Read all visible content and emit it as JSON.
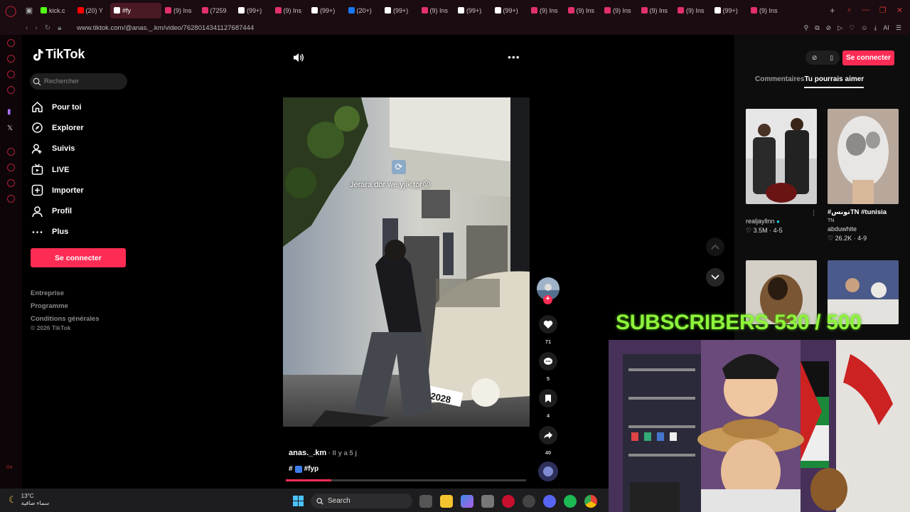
{
  "browser": {
    "tabs": [
      {
        "label": "",
        "color": "#ffffff",
        "icon": "grid-icon"
      },
      {
        "label": "kick.c",
        "color": "#53fc18",
        "icon": "kick-icon"
      },
      {
        "label": "(20) Y",
        "color": "#ff0000",
        "icon": "youtube-icon"
      },
      {
        "label": "#fy",
        "color": "#ffffff",
        "icon": "tiktok-icon",
        "active": true
      },
      {
        "label": "(9) Ins",
        "color": "#e1306c",
        "icon": "instagram-icon"
      },
      {
        "label": "(7259",
        "color": "#e1306c",
        "icon": "instagram-icon"
      },
      {
        "label": "(99+)",
        "color": "#ffffff",
        "icon": "tiktok-icon"
      },
      {
        "label": "(9) Ins",
        "color": "#e1306c",
        "icon": "instagram-icon"
      },
      {
        "label": "(99+)",
        "color": "#ffffff",
        "icon": "tiktok-icon"
      },
      {
        "label": "(20+)",
        "color": "#1877f2",
        "icon": "facebook-icon"
      },
      {
        "label": "(99+)",
        "color": "#ffffff",
        "icon": "tiktok-icon"
      },
      {
        "label": "(9) Ins",
        "color": "#e1306c",
        "icon": "instagram-icon"
      },
      {
        "label": "(99+)",
        "color": "#ffffff",
        "icon": "tiktok-icon"
      },
      {
        "label": "(99+)",
        "color": "#ffffff",
        "icon": "tiktok-icon"
      },
      {
        "label": "(9) Ins",
        "color": "#e1306c",
        "icon": "instagram-icon"
      },
      {
        "label": "(9) Ins",
        "color": "#e1306c",
        "icon": "instagram-icon"
      },
      {
        "label": "(9) Ins",
        "color": "#e1306c",
        "icon": "instagram-icon"
      },
      {
        "label": "(9) Ins",
        "color": "#e1306c",
        "icon": "instagram-icon"
      },
      {
        "label": "(9) Ins",
        "color": "#e1306c",
        "icon": "instagram-icon"
      },
      {
        "label": "(99+)",
        "color": "#ffffff",
        "icon": "tiktok-icon"
      },
      {
        "label": "(9) Ins",
        "color": "#e1306c",
        "icon": "instagram-icon"
      }
    ],
    "url": "www.tiktok.com/@anas._.km/video/7628014341127687444",
    "ai_label": "AI"
  },
  "tiktok": {
    "logo": "TikTok",
    "search_placeholder": "Rechercher",
    "nav": [
      {
        "label": "Pour toi",
        "icon": "home-icon"
      },
      {
        "label": "Explorer",
        "icon": "compass-icon"
      },
      {
        "label": "Suivis",
        "icon": "following-icon"
      },
      {
        "label": "LIVE",
        "icon": "live-icon"
      },
      {
        "label": "Importer",
        "icon": "upload-icon"
      },
      {
        "label": "Profil",
        "icon": "profile-icon"
      },
      {
        "label": "Plus",
        "icon": "more-icon"
      }
    ],
    "login_label": "Se connecter",
    "footer": {
      "links": [
        "Entreprise",
        "Programme",
        "Conditions générales"
      ],
      "copyright": "© 2026 TikTok"
    },
    "accent": "#fe2c55"
  },
  "video": {
    "caption": "Jerara dor we yjik tor😝",
    "author": "anas._.km",
    "time": " · Il y a 5 j",
    "hashtag": "#fyp",
    "hashtag_prefix": "#",
    "progress": 0.19,
    "likes": "71",
    "comments": "5",
    "saves": "4",
    "shares": "40",
    "plate": "2028"
  },
  "right_panel": {
    "login_label": "Se connecter",
    "tabs": [
      "Commentaires",
      "Tu pourrais aimer"
    ],
    "cards": [
      {
        "title": "",
        "user": "realjayllnn",
        "likes": "3.5M",
        "date": "4-5",
        "verified": true
      },
      {
        "title": "#تونسTN #tunisia",
        "title_line2": "TN",
        "user": "abduwhite",
        "likes": "26.2K",
        "date": "4-9",
        "verified": false
      }
    ]
  },
  "overlay": {
    "subscribers": "SUBSCRIBERS 530 / 500"
  },
  "taskbar": {
    "temperature": "13°C",
    "weather_text": "سماء صافية",
    "search": "Search"
  }
}
